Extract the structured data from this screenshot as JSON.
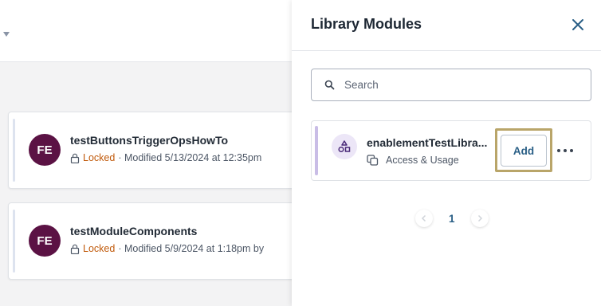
{
  "background": {
    "modules": [
      {
        "avatar_initials": "FE",
        "title": "testButtonsTriggerOpsHowTo",
        "status": "Locked",
        "meta": "· Modified 5/13/2024 at 12:35pm"
      },
      {
        "avatar_initials": "FE",
        "title": "testModuleComponents",
        "status": "Locked",
        "meta": "· Modified 5/9/2024 at 1:18pm by"
      }
    ]
  },
  "panel": {
    "title": "Library Modules",
    "close_icon": "close-icon",
    "search": {
      "placeholder": "Search",
      "value": ""
    },
    "library_items": [
      {
        "name": "enablementTestLibra...",
        "icon": "module-shapes-icon",
        "usage_label": "Access & Usage",
        "add_label": "Add"
      }
    ],
    "pagination": {
      "current_page": "1"
    }
  },
  "colors": {
    "avatar": "#5b1244",
    "locked": "#c15a0b",
    "accent_blue": "#2a5f86",
    "highlight": "#b9a569",
    "library_accent": "#c9bde6"
  }
}
